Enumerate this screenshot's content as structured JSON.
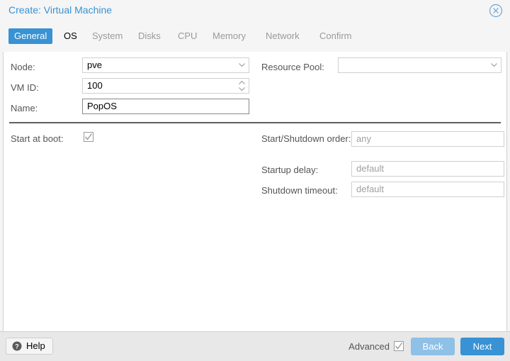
{
  "window": {
    "title": "Create: Virtual Machine",
    "close_icon": "close-circle-icon"
  },
  "tabs": [
    {
      "label": "General",
      "state": "active"
    },
    {
      "label": "OS",
      "state": "enabled"
    },
    {
      "label": "System",
      "state": "disabled"
    },
    {
      "label": "Disks",
      "state": "disabled"
    },
    {
      "label": "CPU",
      "state": "disabled"
    },
    {
      "label": "Memory",
      "state": "disabled"
    },
    {
      "label": "Network",
      "state": "disabled"
    },
    {
      "label": "Confirm",
      "state": "disabled"
    }
  ],
  "form": {
    "node": {
      "label": "Node:",
      "value": "pve",
      "icon": "chevron-down-icon"
    },
    "vmid": {
      "label": "VM ID:",
      "value": "100",
      "icon": "spinner-updown-icon"
    },
    "name": {
      "label": "Name:",
      "value": "PopOS"
    },
    "resource_pool": {
      "label": "Resource Pool:",
      "value": "",
      "icon": "chevron-down-icon"
    },
    "start_at_boot": {
      "label": "Start at boot:",
      "checked": true
    },
    "start_shutdown_order": {
      "label": "Start/Shutdown order:",
      "value": "",
      "placeholder": "any"
    },
    "startup_delay": {
      "label": "Startup delay:",
      "value": "",
      "placeholder": "default"
    },
    "shutdown_timeout": {
      "label": "Shutdown timeout:",
      "value": "",
      "placeholder": "default"
    }
  },
  "footer": {
    "help_label": "Help",
    "help_icon": "question-circle-icon",
    "advanced_label": "Advanced",
    "advanced_checked": true,
    "back_label": "Back",
    "next_label": "Next"
  },
  "colors": {
    "accent": "#3892d4",
    "accent_disabled": "#8fc0e6",
    "title": "#3892d4",
    "label": "#555555",
    "tab_disabled": "#9a9a9a",
    "placeholder": "#a0a0a0"
  }
}
